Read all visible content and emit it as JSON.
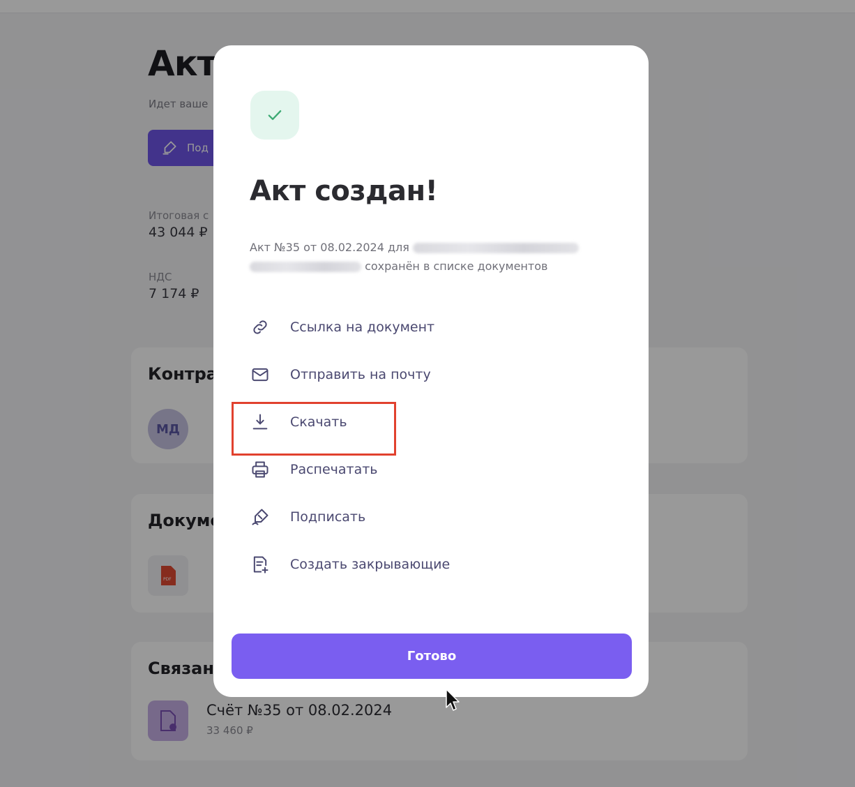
{
  "background": {
    "page_title": "Акт",
    "subtitle": "Идет ваше",
    "sign_button_label": "Под",
    "total_label": "Итоговая с",
    "total_value": "43 044 ₽",
    "vat_label": "НДС",
    "vat_value": "7 174 ₽",
    "counterparty_card_title": "Контра",
    "avatar_initials": "МД",
    "documents_card_title": "Докуме",
    "pdf_badge": "PDF",
    "linked_card_title": "Связанн",
    "linked_doc_title": "Счёт №35 от 08.02.2024",
    "linked_doc_amount": "33 460 ₽"
  },
  "modal": {
    "title": "Акт создан!",
    "desc_part1": "Акт №35 от 08.02.2024 для",
    "desc_part2": "сохранён в списке документов",
    "actions": [
      {
        "label": "Ссылка на документ",
        "icon": "link-icon"
      },
      {
        "label": "Отправить на почту",
        "icon": "mail-icon"
      },
      {
        "label": "Скачать",
        "icon": "download-icon"
      },
      {
        "label": "Распечатать",
        "icon": "printer-icon"
      },
      {
        "label": "Подписать",
        "icon": "signature-pen-icon"
      },
      {
        "label": "Создать закрывающие",
        "icon": "document-add-icon"
      }
    ],
    "done_button": "Готово"
  },
  "colors": {
    "accent": "#7a5ef0",
    "success_bg": "#e4f6ee",
    "success_check": "#3daa74",
    "highlight": "#e1412e",
    "action_icon": "#4a4870"
  }
}
